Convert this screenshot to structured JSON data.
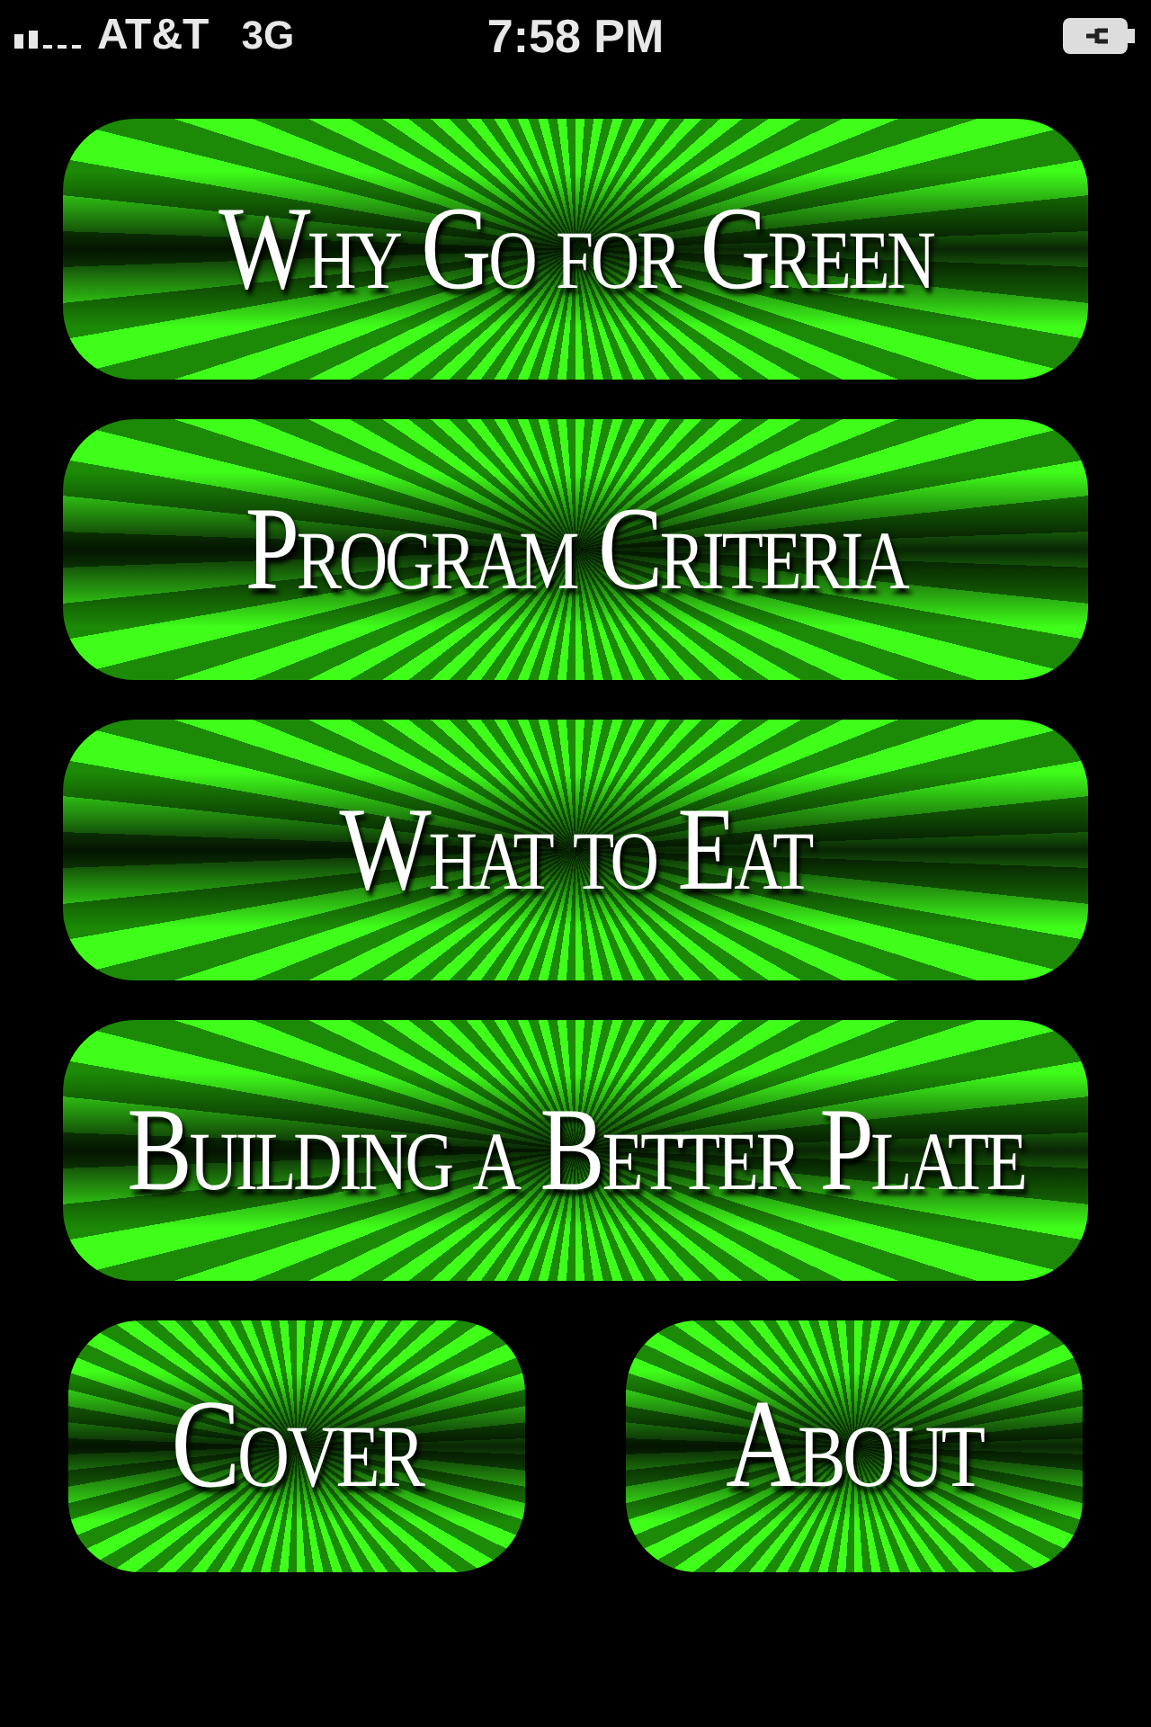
{
  "status_bar": {
    "carrier": "AT&T",
    "network": "3G",
    "time": "7:58 PM"
  },
  "menu": [
    {
      "label": "Why Go for Green"
    },
    {
      "label": "Program Criteria"
    },
    {
      "label": "What to Eat"
    },
    {
      "label": "Building a Better Plate"
    }
  ],
  "bottom_buttons": [
    {
      "label": "Cover"
    },
    {
      "label": "About"
    }
  ]
}
